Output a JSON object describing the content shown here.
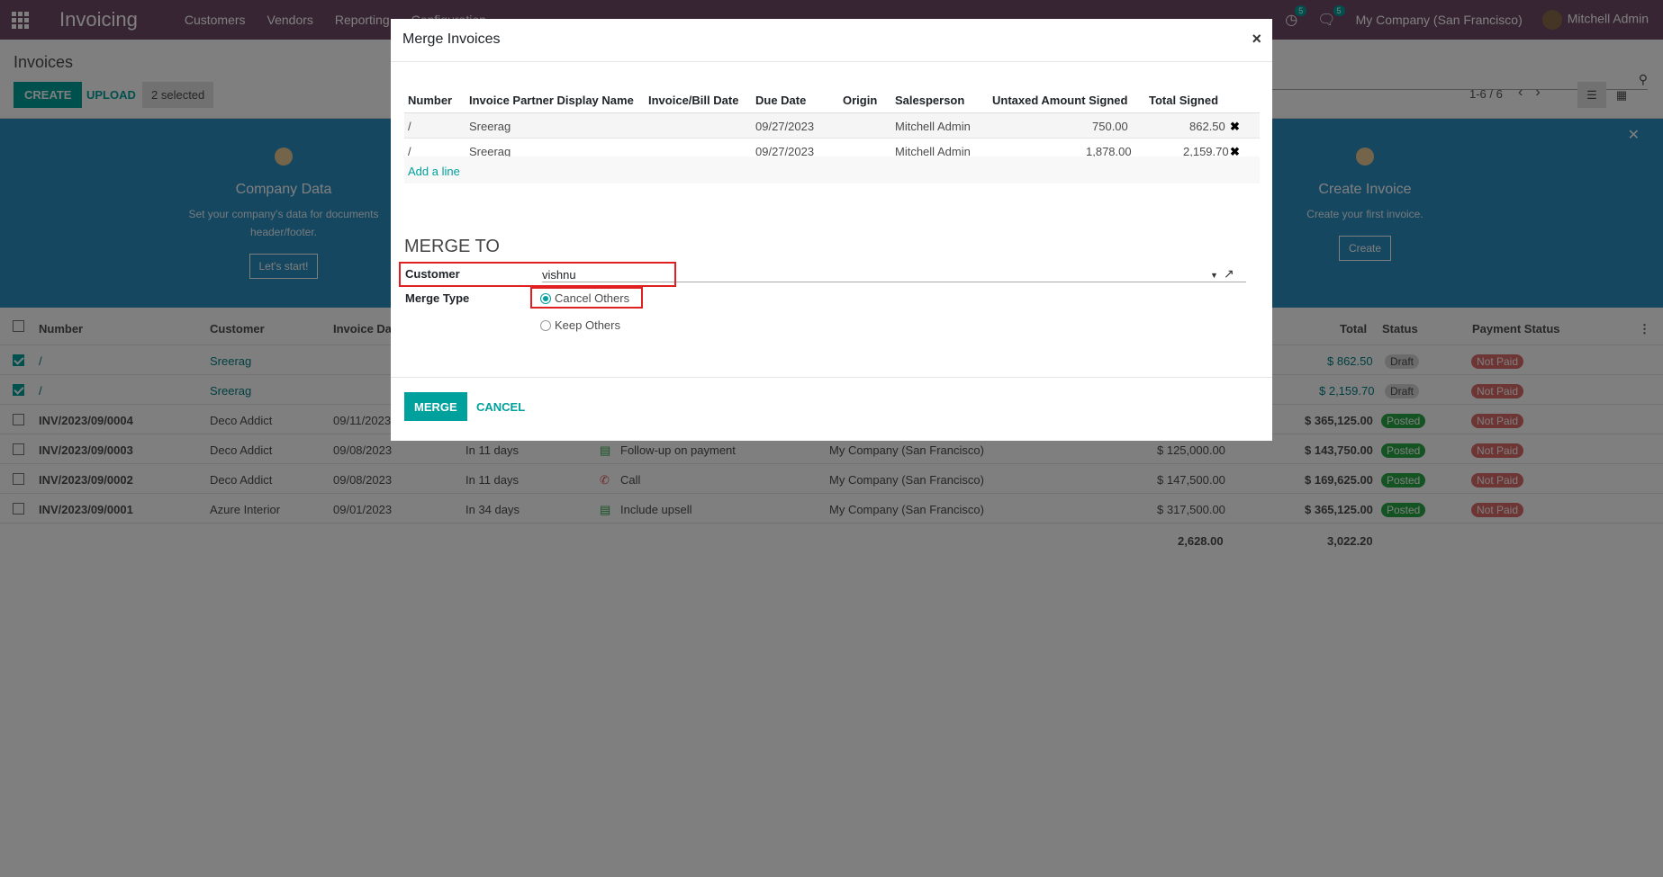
{
  "navbar": {
    "app_name": "Invoicing",
    "menu": [
      "Customers",
      "Vendors",
      "Reporting",
      "Configuration"
    ],
    "activity_count": "5",
    "messages_count": "5",
    "company": "My Company (San Francisco)",
    "user": "Mitchell Admin"
  },
  "control": {
    "breadcrumb": "Invoices",
    "create_label": "CREATE",
    "upload_label": "UPLOAD",
    "selected_label": "2 selected",
    "pager": "1-6 / 6"
  },
  "banner": {
    "step1_title": "Company Data",
    "step1_desc": "Set your company's data for documents header/footer.",
    "step1_btn": "Let's start!",
    "step2_title": "Create Invoice",
    "step2_desc": "Create your first invoice.",
    "step2_btn": "Create"
  },
  "list": {
    "headers": {
      "number": "Number",
      "customer": "Customer",
      "invoice_date": "Invoice Date",
      "total": "Total",
      "status": "Status",
      "payment_status": "Payment Status"
    },
    "rows": [
      {
        "number": "/",
        "customer": "Sreerag",
        "invoice_date": "",
        "due": "",
        "activity": "",
        "company": "",
        "untaxed": "",
        "total": "$ 862.50",
        "status": "Draft",
        "payment": "Not Paid"
      },
      {
        "number": "/",
        "customer": "Sreerag",
        "invoice_date": "",
        "due": "",
        "activity": "",
        "company": "",
        "untaxed": "",
        "total": "$ 2,159.70",
        "status": "Draft",
        "payment": "Not Paid"
      },
      {
        "number": "INV/2023/09/0004",
        "customer": "Deco Addict",
        "invoice_date": "09/11/2023",
        "due": "",
        "activity": "",
        "company": "",
        "untaxed": "",
        "total": "$ 365,125.00",
        "status": "Posted",
        "payment": "Not Paid"
      },
      {
        "number": "INV/2023/09/0003",
        "customer": "Deco Addict",
        "invoice_date": "09/08/2023",
        "due": "In 11 days",
        "activity": "Follow-up on payment",
        "company": "My Company (San Francisco)",
        "untaxed": "$ 125,000.00",
        "total": "$ 143,750.00",
        "status": "Posted",
        "payment": "Not Paid"
      },
      {
        "number": "INV/2023/09/0002",
        "customer": "Deco Addict",
        "invoice_date": "09/08/2023",
        "due": "In 11 days",
        "activity": "Call",
        "company": "My Company (San Francisco)",
        "untaxed": "$ 147,500.00",
        "total": "$ 169,625.00",
        "status": "Posted",
        "payment": "Not Paid"
      },
      {
        "number": "INV/2023/09/0001",
        "customer": "Azure Interior",
        "invoice_date": "09/01/2023",
        "due": "In 34 days",
        "activity": "Include upsell",
        "company": "My Company (San Francisco)",
        "untaxed": "$ 317,500.00",
        "total": "$ 365,125.00",
        "status": "Posted",
        "payment": "Not Paid"
      }
    ],
    "sum_untaxed": "2,628.00",
    "sum_total": "3,022.20"
  },
  "modal": {
    "title": "Merge Invoices",
    "close": "×",
    "columns": [
      "Number",
      "Invoice Partner Display Name",
      "Invoice/Bill Date",
      "Due Date",
      "Origin",
      "Salesperson",
      "Untaxed Amount Signed",
      "Total Signed"
    ],
    "rows": [
      {
        "number": "/",
        "partner": "Sreerag",
        "inv_date": "",
        "due_date": "09/27/2023",
        "origin": "",
        "salesperson": "Mitchell Admin",
        "untaxed": "750.00",
        "total": "862.50"
      },
      {
        "number": "/",
        "partner": "Sreerag",
        "inv_date": "",
        "due_date": "09/27/2023",
        "origin": "",
        "salesperson": "Mitchell Admin",
        "untaxed": "1,878.00",
        "total": "2,159.70"
      }
    ],
    "add_line": "Add a line",
    "merge_to_title": "MERGE TO",
    "customer_label": "Customer",
    "customer_value": "vishnu",
    "merge_type_label": "Merge Type",
    "merge_type_options": [
      "Cancel Others",
      "Keep Others"
    ],
    "merge_type_selected": "Cancel Others",
    "merge_button": "MERGE",
    "cancel_button": "CANCEL"
  },
  "colors": {
    "navbar": "#714b67",
    "accent": "#00a09d",
    "banner": "#2b8fc2",
    "highlight": "#e02020"
  }
}
